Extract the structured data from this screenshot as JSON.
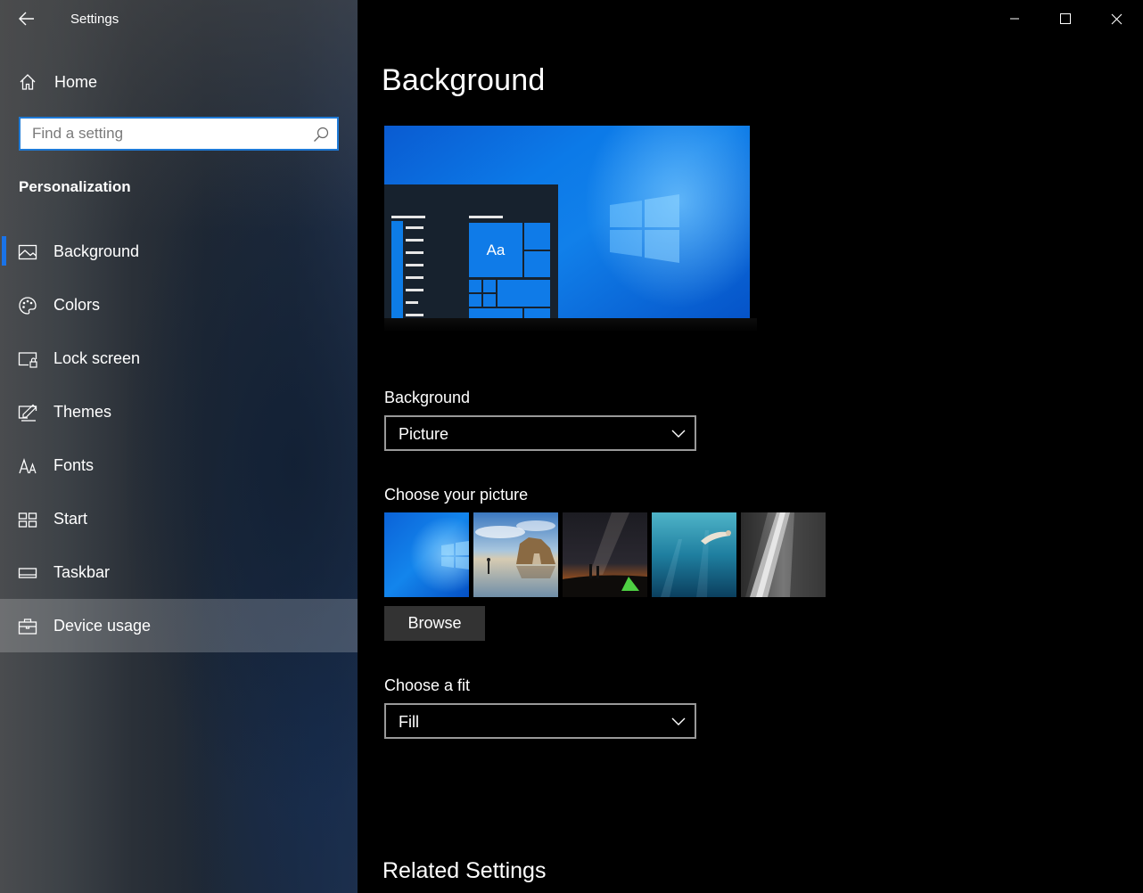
{
  "window": {
    "title": "Settings",
    "controls": [
      "minimize",
      "maximize",
      "close"
    ]
  },
  "sidebar": {
    "home_label": "Home",
    "search": {
      "placeholder": "Find a setting"
    },
    "section_heading": "Personalization",
    "items": [
      {
        "label": "Background",
        "icon": "picture-icon",
        "selected": true
      },
      {
        "label": "Colors",
        "icon": "palette-icon"
      },
      {
        "label": "Lock screen",
        "icon": "lock-screen-icon"
      },
      {
        "label": "Themes",
        "icon": "themes-icon"
      },
      {
        "label": "Fonts",
        "icon": "fonts-icon"
      },
      {
        "label": "Start",
        "icon": "start-icon"
      },
      {
        "label": "Taskbar",
        "icon": "taskbar-icon"
      },
      {
        "label": "Device usage",
        "icon": "device-usage-icon",
        "hovered": true
      }
    ]
  },
  "main": {
    "page_title": "Background",
    "preview": {
      "tile_text": "Aa"
    },
    "background_label": "Background",
    "background_value": "Picture",
    "choose_picture_label": "Choose your picture",
    "pictures": [
      "windows-hero",
      "beach-rock-arch",
      "milky-way-tent",
      "underwater-swimmer",
      "rock-cliff"
    ],
    "browse_label": "Browse",
    "fit_label": "Choose a fit",
    "fit_value": "Fill",
    "related_heading": "Related Settings"
  },
  "colors": {
    "accent": "#1a73e8",
    "main_bg": "#000000",
    "button_bg": "#333333",
    "dropdown_border": "#999999"
  }
}
